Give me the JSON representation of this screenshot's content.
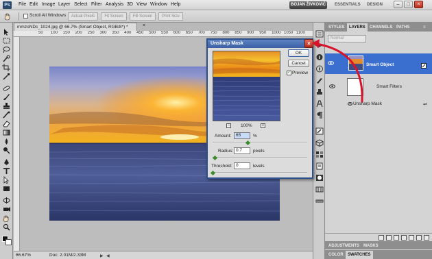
{
  "app": {
    "logo": "Ps",
    "menu": [
      "File",
      "Edit",
      "Image",
      "Layer",
      "Select",
      "Filter",
      "Analysis",
      "3D",
      "View",
      "Window",
      "Help"
    ],
    "workspace_label": "BOJAN ŽIVKOVIĆ",
    "workspace_links": [
      "ESSENTIALS",
      "DESIGN"
    ],
    "window_buttons": [
      "–",
      "□",
      "×"
    ]
  },
  "options_bar": {
    "scroll_all_label": "Scroll All Windows",
    "buttons": [
      "Actual Pixels",
      "Fit Screen",
      "Fill Screen",
      "Print Size"
    ]
  },
  "document": {
    "tab_title": "mmzoNDc_1024.jpg @ 66.7% (Smart Object, RGB/8*) *",
    "close": "×",
    "ruler_marks": [
      "50",
      "100",
      "150",
      "200",
      "250",
      "300",
      "350",
      "400",
      "450",
      "500",
      "550",
      "600",
      "650",
      "700",
      "750",
      "800",
      "850",
      "900",
      "950",
      "1000",
      "1050",
      "1100"
    ],
    "zoom": "66.67%",
    "doc_info": "Doc: 2.01M/2.33M"
  },
  "dialog": {
    "title": "Unsharp Mask",
    "close": "×",
    "ok_label": "OK",
    "cancel_label": "Cancel",
    "preview_label": "Preview",
    "preview_checked": true,
    "preview_check_glyph": "✓",
    "zoom_out": "−",
    "zoom_in": "+",
    "zoom_pct": "100%",
    "amount_label": "Amount:",
    "amount_value": "65",
    "amount_unit": "%",
    "amount_level": 0.37,
    "radius_label": "Radius:",
    "radius_value": "0.7",
    "radius_unit": "pixels",
    "radius_level": 0.02,
    "threshold_label": "Threshold:",
    "threshold_value": "0",
    "threshold_unit": "levels",
    "threshold_level": 0.0
  },
  "panels": {
    "top_tabs": [
      "STYLES",
      "LAYERS",
      "CHANNELS",
      "PATHS"
    ],
    "active_tab": "LAYERS",
    "blend_mode": "Normal",
    "layer_name": "Smart Object",
    "smart_filters_label": "Smart Filters",
    "filter_name": "Unsharp Mask",
    "bottom_tabs_1": [
      "ADJUSTMENTS",
      "MASKS"
    ],
    "bottom_tabs_2": [
      "COLOR",
      "SWATCHES"
    ],
    "active_bottom_tab": "SWATCHES"
  },
  "colors": {
    "accent_blue": "#3a6fcf",
    "annotation_red": "#d9142a",
    "dialog_title_blue": "#3a5fa3"
  }
}
